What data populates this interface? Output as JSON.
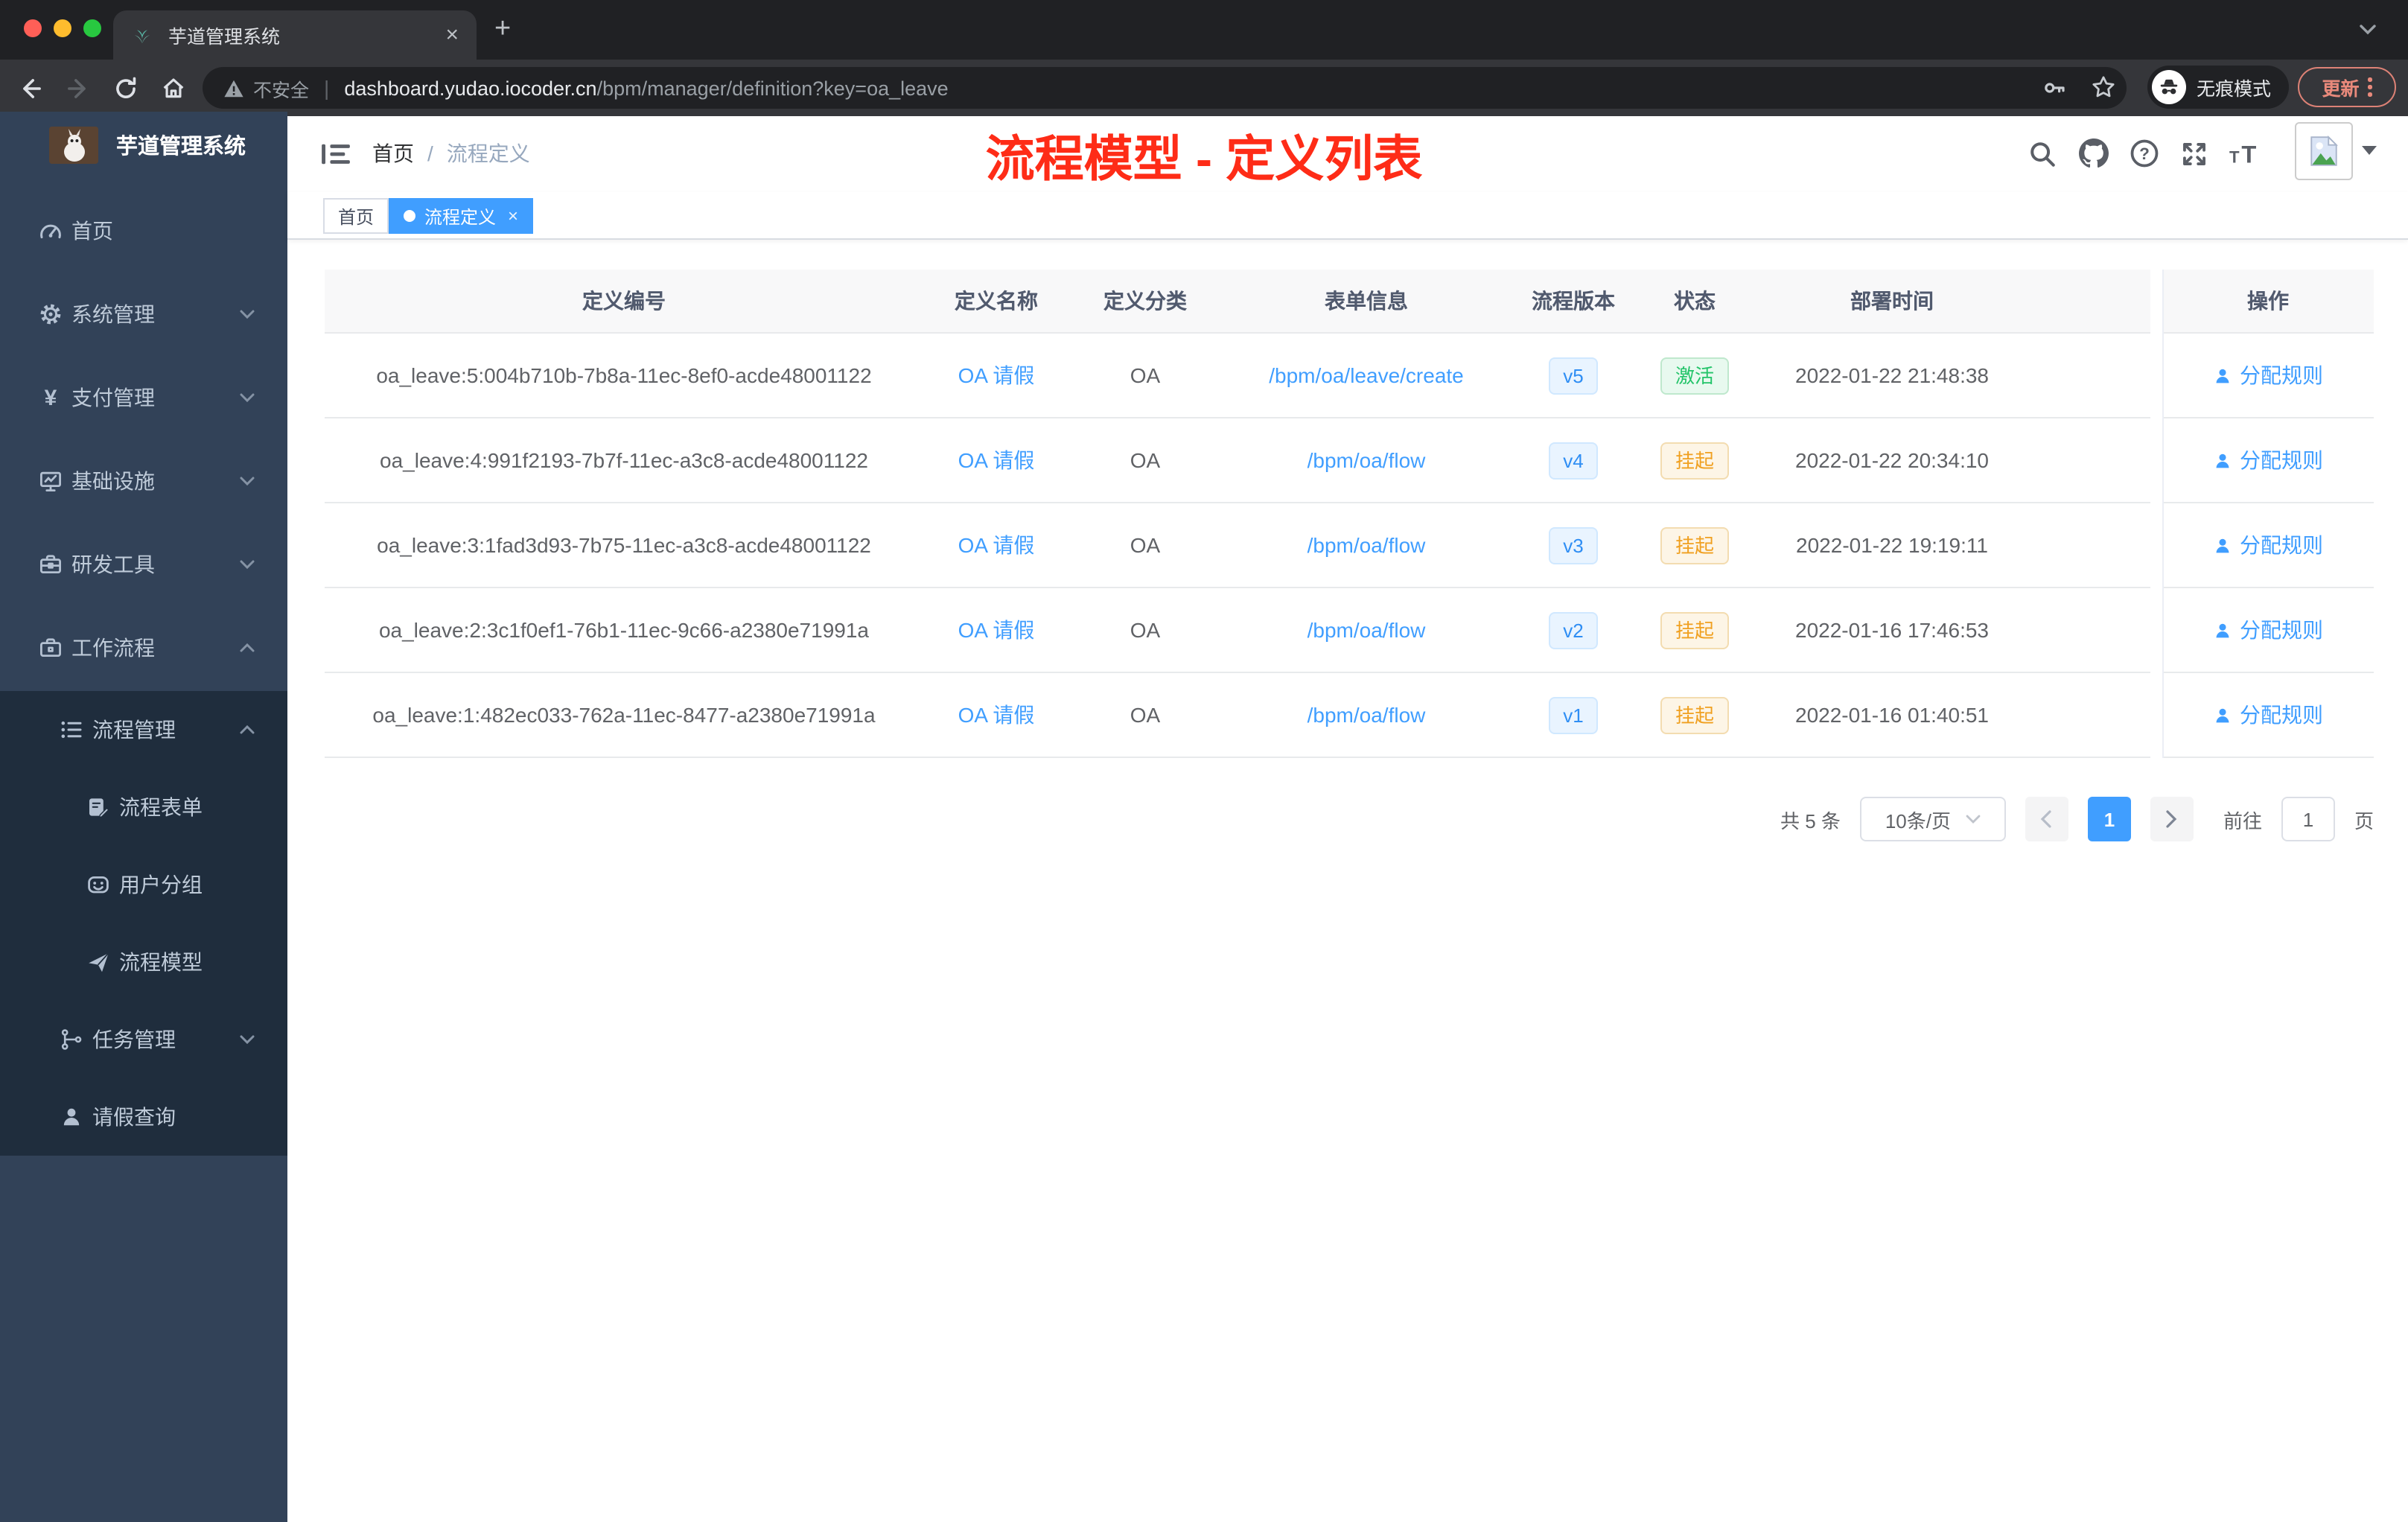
{
  "browser": {
    "tab": {
      "title": "芋道管理系统",
      "close": "×",
      "new_tab": "+"
    },
    "address": {
      "warning_label": "不安全",
      "domain": "dashboard.yudao.iocoder.cn",
      "path": "/bpm/manager/definition?key=oa_leave"
    },
    "incognito_label": "无痕模式",
    "update_label": "更新"
  },
  "sidebar": {
    "logo_title": "芋道管理系统",
    "menu": [
      {
        "label": "首页",
        "icon": "dashboard-icon"
      },
      {
        "label": "系统管理",
        "icon": "gear-icon"
      },
      {
        "label": "支付管理",
        "icon": "yen-icon"
      },
      {
        "label": "基础设施",
        "icon": "monitor-icon"
      },
      {
        "label": "研发工具",
        "icon": "toolbox-icon"
      },
      {
        "label": "工作流程",
        "icon": "briefcase-icon"
      }
    ],
    "submenu": [
      {
        "label": "流程管理",
        "icon": "list-icon"
      },
      {
        "label": "流程表单",
        "icon": "form-icon"
      },
      {
        "label": "用户分组",
        "icon": "user-group-icon"
      },
      {
        "label": "流程模型",
        "icon": "paper-plane-icon"
      },
      {
        "label": "任务管理",
        "icon": "tree-icon"
      },
      {
        "label": "请假查询",
        "icon": "person-icon"
      }
    ]
  },
  "navbar": {
    "breadcrumb_home": "首页",
    "breadcrumb_sep": "/",
    "breadcrumb_current": "流程定义",
    "annotation": "流程模型 - 定义列表"
  },
  "tags": {
    "home": "首页",
    "active": "流程定义",
    "close": "×"
  },
  "table": {
    "columns": {
      "id": "定义编号",
      "name": "定义名称",
      "category": "定义分类",
      "form": "表单信息",
      "version": "流程版本",
      "status": "状态",
      "deploy_time": "部署时间",
      "actions": "操作"
    },
    "rows": [
      {
        "id": "oa_leave:5:004b710b-7b8a-11ec-8ef0-acde48001122",
        "name": "OA 请假",
        "category": "OA",
        "form": "/bpm/oa/leave/create",
        "version": "v5",
        "status": "激活",
        "time": "2022-01-22 21:48:38",
        "action": "分配规则"
      },
      {
        "id": "oa_leave:4:991f2193-7b7f-11ec-a3c8-acde48001122",
        "name": "OA 请假",
        "category": "OA",
        "form": "/bpm/oa/flow",
        "version": "v4",
        "status": "挂起",
        "time": "2022-01-22 20:34:10",
        "action": "分配规则"
      },
      {
        "id": "oa_leave:3:1fad3d93-7b75-11ec-a3c8-acde48001122",
        "name": "OA 请假",
        "category": "OA",
        "form": "/bpm/oa/flow",
        "version": "v3",
        "status": "挂起",
        "time": "2022-01-22 19:19:11",
        "action": "分配规则"
      },
      {
        "id": "oa_leave:2:3c1f0ef1-76b1-11ec-9c66-a2380e71991a",
        "name": "OA 请假",
        "category": "OA",
        "form": "/bpm/oa/flow",
        "version": "v2",
        "status": "挂起",
        "time": "2022-01-16 17:46:53",
        "action": "分配规则"
      },
      {
        "id": "oa_leave:1:482ec033-762a-11ec-8477-a2380e71991a",
        "name": "OA 请假",
        "category": "OA",
        "form": "/bpm/oa/flow",
        "version": "v1",
        "status": "挂起",
        "time": "2022-01-16 01:40:51",
        "action": "分配规则"
      }
    ]
  },
  "pagination": {
    "total": "共 5 条",
    "page_size": "10条/页",
    "page": "1",
    "goto": "前往",
    "goto_value": "1",
    "unit": "页"
  },
  "colors": {
    "accent": "#409eff",
    "annotation_red": "#fe2c17",
    "status_active_green": "#23c469",
    "status_suspend_orange": "#f0a020",
    "sidebar_bg": "#324258",
    "submenu_bg": "#1f2d3d"
  }
}
